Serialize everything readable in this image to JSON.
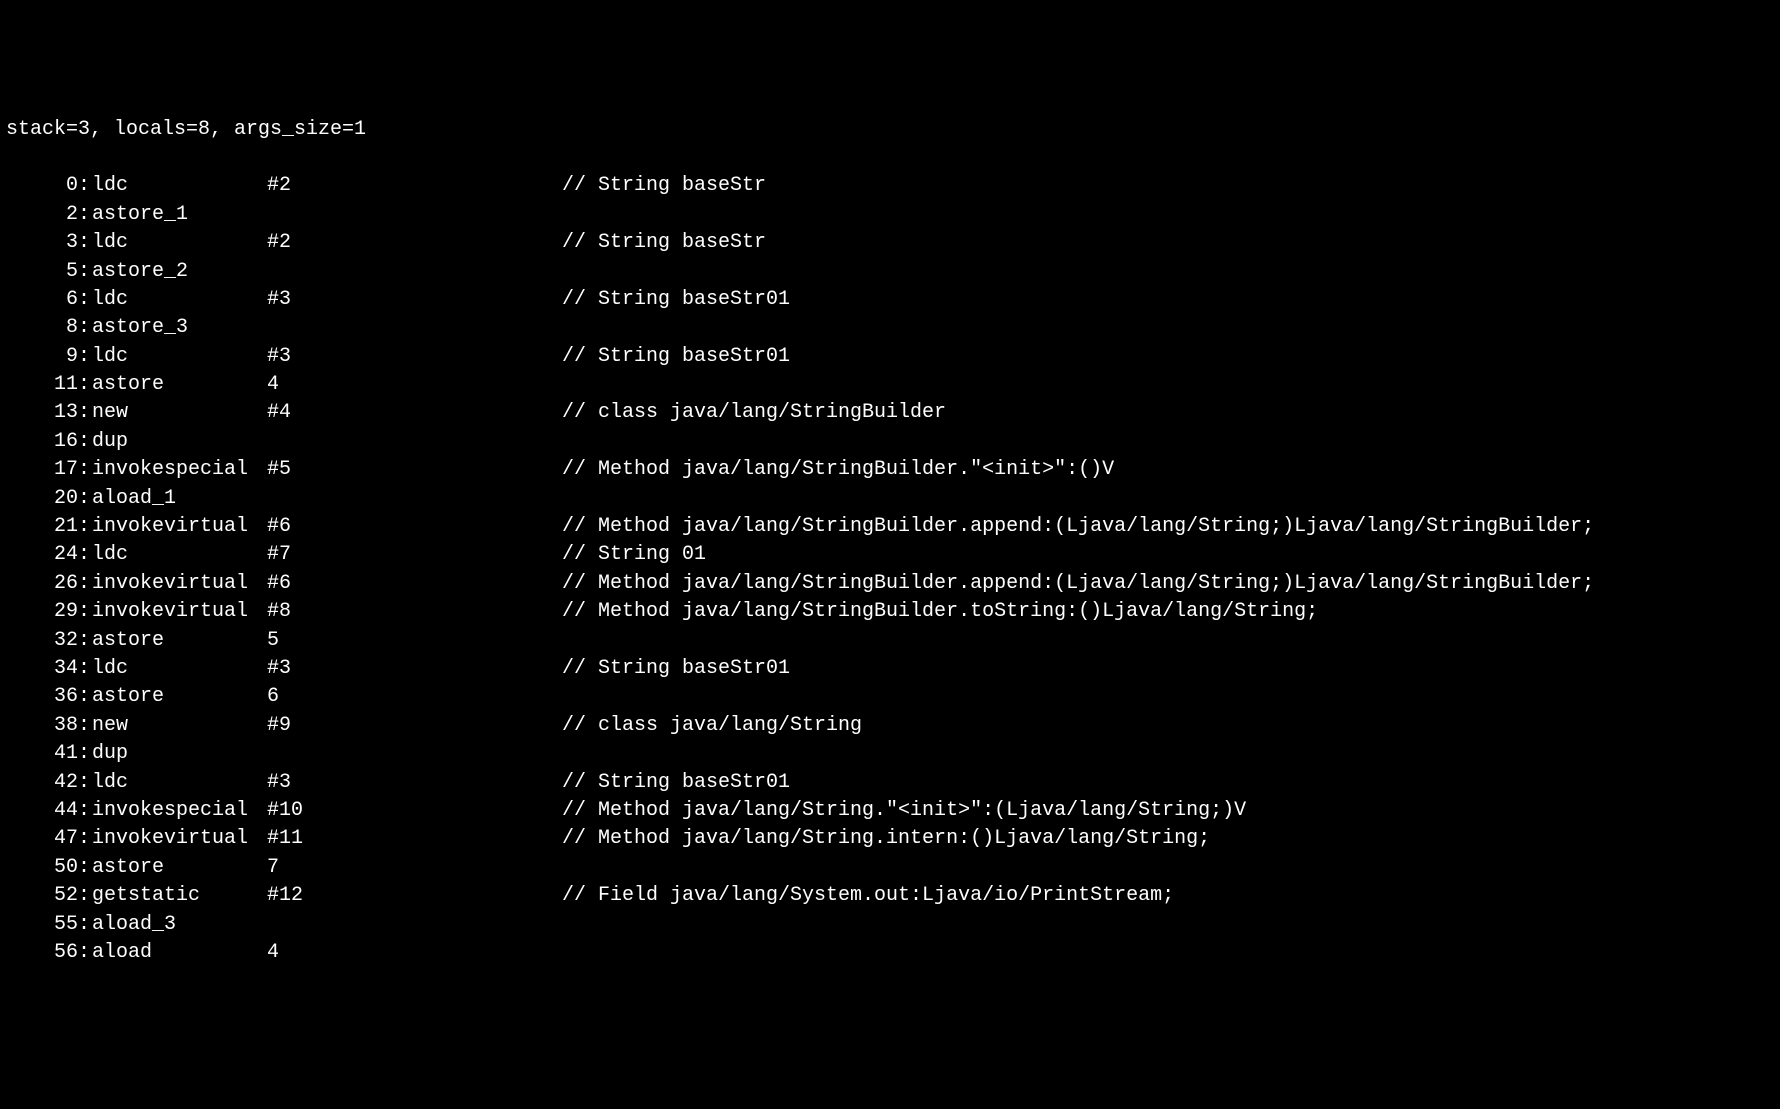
{
  "header": "stack=3, locals=8, args_size=1",
  "instructions": [
    {
      "addr": "0",
      "opcode": "ldc",
      "operand": "#2",
      "comment": "// String baseStr"
    },
    {
      "addr": "2",
      "opcode": "astore_1",
      "operand": "",
      "comment": ""
    },
    {
      "addr": "3",
      "opcode": "ldc",
      "operand": "#2",
      "comment": "// String baseStr"
    },
    {
      "addr": "5",
      "opcode": "astore_2",
      "operand": "",
      "comment": ""
    },
    {
      "addr": "6",
      "opcode": "ldc",
      "operand": "#3",
      "comment": "// String baseStr01"
    },
    {
      "addr": "8",
      "opcode": "astore_3",
      "operand": "",
      "comment": ""
    },
    {
      "addr": "9",
      "opcode": "ldc",
      "operand": "#3",
      "comment": "// String baseStr01"
    },
    {
      "addr": "11",
      "opcode": "astore",
      "operand": "4",
      "comment": ""
    },
    {
      "addr": "13",
      "opcode": "new",
      "operand": "#4",
      "comment": "// class java/lang/StringBuilder"
    },
    {
      "addr": "16",
      "opcode": "dup",
      "operand": "",
      "comment": ""
    },
    {
      "addr": "17",
      "opcode": "invokespecial",
      "operand": "#5",
      "comment": "// Method java/lang/StringBuilder.\"<init>\":()V"
    },
    {
      "addr": "20",
      "opcode": "aload_1",
      "operand": "",
      "comment": ""
    },
    {
      "addr": "21",
      "opcode": "invokevirtual",
      "operand": "#6",
      "comment": "// Method java/lang/StringBuilder.append:(Ljava/lang/String;)Ljava/lang/StringBuilder;"
    },
    {
      "addr": "24",
      "opcode": "ldc",
      "operand": "#7",
      "comment": "// String 01"
    },
    {
      "addr": "26",
      "opcode": "invokevirtual",
      "operand": "#6",
      "comment": "// Method java/lang/StringBuilder.append:(Ljava/lang/String;)Ljava/lang/StringBuilder;"
    },
    {
      "addr": "29",
      "opcode": "invokevirtual",
      "operand": "#8",
      "comment": "// Method java/lang/StringBuilder.toString:()Ljava/lang/String;"
    },
    {
      "addr": "32",
      "opcode": "astore",
      "operand": "5",
      "comment": ""
    },
    {
      "addr": "34",
      "opcode": "ldc",
      "operand": "#3",
      "comment": "// String baseStr01"
    },
    {
      "addr": "36",
      "opcode": "astore",
      "operand": "6",
      "comment": ""
    },
    {
      "addr": "38",
      "opcode": "new",
      "operand": "#9",
      "comment": "// class java/lang/String"
    },
    {
      "addr": "41",
      "opcode": "dup",
      "operand": "",
      "comment": ""
    },
    {
      "addr": "42",
      "opcode": "ldc",
      "operand": "#3",
      "comment": "// String baseStr01"
    },
    {
      "addr": "44",
      "opcode": "invokespecial",
      "operand": "#10",
      "comment": "// Method java/lang/String.\"<init>\":(Ljava/lang/String;)V"
    },
    {
      "addr": "47",
      "opcode": "invokevirtual",
      "operand": "#11",
      "comment": "// Method java/lang/String.intern:()Ljava/lang/String;"
    },
    {
      "addr": "50",
      "opcode": "astore",
      "operand": "7",
      "comment": ""
    },
    {
      "addr": "52",
      "opcode": "getstatic",
      "operand": "#12",
      "comment": "// Field java/lang/System.out:Ljava/io/PrintStream;"
    },
    {
      "addr": "55",
      "opcode": "aload_3",
      "operand": "",
      "comment": ""
    },
    {
      "addr": "56",
      "opcode": "aload",
      "operand": "4",
      "comment": ""
    }
  ]
}
